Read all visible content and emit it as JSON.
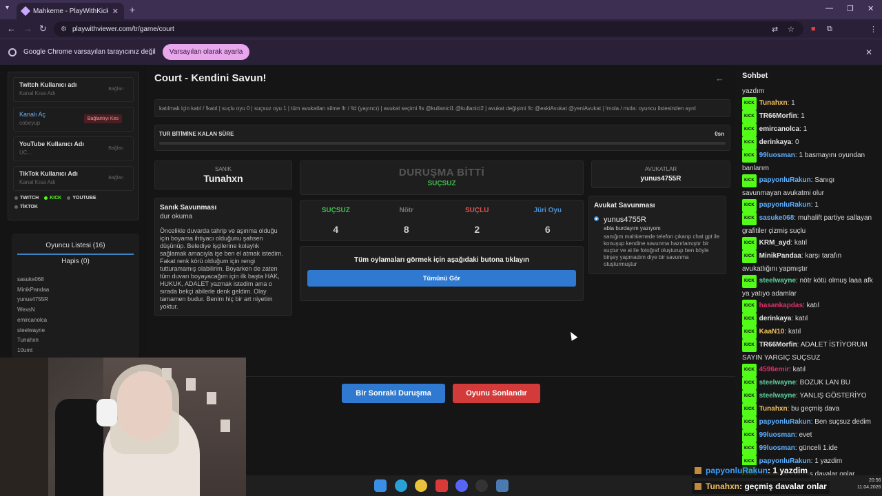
{
  "browser": {
    "tab_title": "Mahkeme - PlayWithKick | Play",
    "url": "playwithviewer.com/tr/game/court",
    "infobar_text": "Google Chrome varsayılan tarayıcınız değil",
    "infobar_button": "Varsayılan olarak ayarla"
  },
  "accounts": [
    {
      "label": "Twitch Kullanıcı adı",
      "sub": "Kanal Kısa Adı",
      "button": "Bağlan"
    },
    {
      "label": "Kanalı Aç",
      "sub": "cobeyup",
      "button": "Bağlantıyı Kes"
    },
    {
      "label": "YouTube Kullanıcı Adı",
      "sub": "UC...",
      "button": "Bağlan"
    },
    {
      "label": "TikTok Kullanıcı Adı",
      "sub": "Kanal Kısa Adı",
      "button": "Bağlan"
    }
  ],
  "platforms": [
    "TWITCH",
    "KICK",
    "YOUTUBE",
    "TİKTOK"
  ],
  "players": {
    "tab_list": "Oyuncu Listesi (16)",
    "tab_jail": "Hapis (0)",
    "names": [
      "sasuke068",
      "MinikPandaa",
      "yunus4755R",
      "WexsN",
      "emircanolca",
      "steelwayne",
      "Tunahxn",
      "10umt"
    ]
  },
  "court": {
    "title": "Court - Kendini Savun!",
    "commands": "katılmak için katıl / !katıl | suçlu oyu 0 | suçsuz oyu 1 | tüm avukatları silme !lr / !ld (yayıncı) | avukat seçimi !ls @kullanici1 @kullanici2 | avukat değişimi !lc @eskiAvukat @yeniAvukat | !mola / mola: oyuncu listesinden ayrıl",
    "timer_label": "TUR BİTİMİNE KALAN SÜRE",
    "timer_value": "0sn",
    "defendant_label": "SANIK",
    "defendant_name": "Tunahxn",
    "status_title": "DURUŞMA BİTTİ",
    "status_verdict": "SUÇSUZ",
    "lawyers_label": "AVUKATLAR",
    "lawyers_name": "yunus4755R",
    "votes": [
      {
        "label": "SUÇSUZ",
        "value": "4",
        "color": "#3fbf4f"
      },
      {
        "label": "Nötr",
        "value": "8",
        "color": "#777777"
      },
      {
        "label": "SUÇLU",
        "value": "2",
        "color": "#e05454"
      },
      {
        "label": "Jüri Oyu",
        "value": "6",
        "color": "#4a90d9"
      }
    ],
    "defense_title": "Sanık Savunması",
    "defense_sub": "dur okuma",
    "defense_body": "Öncelikle duvarda tahrip ve aşınma olduğu için boyama ihtiyacı olduğunu şahsen düşünüp. Belediye işçilerine kolaylık sağlamak amacıyla işe ben el atmak istedim. Fakat renk körü olduğum için rengi tutturamamış olabilirim. Boyarken de zaten tüm duvarı boyayacağım için ilk başta HAK, HUKUK, ADALET yazmak istedim ama o sırada bekçi abilerle denk geldim. Olay tamamen budur. Benim hiç bir art niyetim yoktur.",
    "all_votes_text": "Tüm oylamaları görmek için aşağıdaki butona tıklayın",
    "all_votes_button": "Tümünü Gör",
    "lawyer_defense_title": "Avukat Savunması",
    "lawyer_entry_name": "yunus4755R",
    "lawyer_entry_sub": "abla burdayım yazıyom",
    "lawyer_entry_body": "sanığım mahkemede telefon çıkarıp chat gpt ile konuşup kendine savunma hazırlamıştır bir suçtur ve ai ile fotoğraf oluşturup ben böyle birşey yapmadım diye bir savunma oluşturmuştur",
    "next_button": "Bir Sonraki Duruşma",
    "end_button": "Oyunu Sonlandır"
  },
  "chat": {
    "title": "Sohbet",
    "first_line": "yazdım",
    "messages": [
      {
        "user": "Tunahxn",
        "color": "#f0c060",
        "text": "1"
      },
      {
        "user": "TR66Morfin",
        "color": "#e6e6e6",
        "text": "1"
      },
      {
        "user": "emircanolca",
        "color": "#e6e6e6",
        "text": "1"
      },
      {
        "user": "derinkaya",
        "color": "#e6e6e6",
        "text": "0"
      },
      {
        "user": "99luosman",
        "color": "#5fb0ff",
        "text": "1 basmayını oyundan banlarım"
      },
      {
        "user": "papyonluRakun",
        "color": "#5fb0ff",
        "text": "Sanıgı savunmayan avukatmi olur"
      },
      {
        "user": "papyonluRakun",
        "color": "#5fb0ff",
        "text": "1"
      },
      {
        "user": "sasuke068",
        "color": "#5fb0ff",
        "text": "muhalift partiye sallayan grafitiler çizmiş suçlu"
      },
      {
        "user": "KRM_ayd",
        "color": "#e6e6e6",
        "text": "katıl"
      },
      {
        "user": "MinikPandaa",
        "color": "#e6e6e6",
        "text": "karşı tarafın avukatlığını yapmıştır"
      },
      {
        "user": "steelwayne",
        "color": "#5fd0a0",
        "text": "nötr kötü olmuş laaa afk ya yatıyo adamlar"
      },
      {
        "user": "hasankapdas",
        "color": "#e0306a",
        "text": "katıl"
      },
      {
        "user": "derinkaya",
        "color": "#e6e6e6",
        "text": "katıl"
      },
      {
        "user": "KaaN10",
        "color": "#f0c060",
        "text": "katıl"
      },
      {
        "user": "TR66Morfin",
        "color": "#e6e6e6",
        "text": "ADALET İSTİYORUM SAYIN YARGIÇ SUÇSUZ"
      },
      {
        "user": "4596emir",
        "color": "#e0306a",
        "text": "katıl"
      },
      {
        "user": "steelwayne",
        "color": "#5fd0a0",
        "text": "BOZUK LAN BU"
      },
      {
        "user": "steelwayne",
        "color": "#5fd0a0",
        "text": "YANLIŞ GÖSTERİYO"
      },
      {
        "user": "Tunahxn",
        "color": "#f0c060",
        "text": "bu geçmiş dava"
      },
      {
        "user": "papyonluRakun",
        "color": "#5fb0ff",
        "text": "Ben suçsuz dedim"
      },
      {
        "user": "99luosman",
        "color": "#5fb0ff",
        "text": "evet"
      },
      {
        "user": "99luosman",
        "color": "#5fb0ff",
        "text": "günceli 1.ide"
      },
      {
        "user": "papyonluRakun",
        "color": "#5fb0ff",
        "text": "1 yazdim"
      },
      {
        "user": "Tunahxn",
        "color": "#f0c060",
        "text": "geçmiş davalar onlar"
      }
    ],
    "badge": "KICK"
  },
  "overlay": [
    {
      "user": "papyonluRakun",
      "text": ": 1 yazdim"
    },
    {
      "user": "Tunahxn",
      "text": ": geçmiş davalar onlar"
    }
  ],
  "clock": {
    "time": "20:56",
    "date": "11.04.2026"
  }
}
